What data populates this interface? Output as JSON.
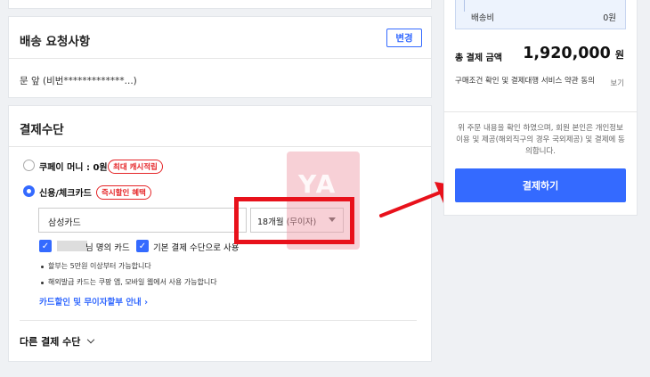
{
  "delivery_request": {
    "title": "배송 요청사항",
    "change_label": "변경",
    "value": "문 앞 (비번*************...)"
  },
  "payment": {
    "title": "결제수단",
    "coupay": {
      "label": "쿠페이 머니 : 0원",
      "badge": "최대 캐시적립"
    },
    "card": {
      "label": "신용/체크카드",
      "badge": "즉시할인 혜택",
      "card_select": "삼성카드",
      "installment_select": "18개월 (무이자)",
      "owner_suffix": "님 명의 카드",
      "default_label": "기본 결제 수단으로 사용",
      "notes": [
        "할부는 5만원 이상부터 가능합니다",
        "해외발급 카드는 쿠팡 앱, 모바일 웹에서 사용 가능합니다"
      ],
      "info_link": "카드할인 및 무이자할부 안내"
    },
    "other_methods": "다른 결제 수단"
  },
  "summary": {
    "shipping_label": "배송비",
    "shipping_value": "0원",
    "total_label": "총 결제 금액",
    "total_amount": "1,920,000",
    "total_unit": "원",
    "terms": "구매조건 확인 및 결제대행 서비스 약관 동의",
    "terms_view": "보기",
    "consent": "위 주문 내용을 확인 하였으며, 회원 본인은 개인정보 이용 및 제공(해외직구의 경우 국외제공) 및 결제에 동의합니다.",
    "pay_button": "결제하기"
  },
  "watermark": "YA",
  "colors": {
    "accent": "#346aff",
    "highlight_red": "#e8111b",
    "badge_red": "#e52528",
    "background": "#eff1f4"
  }
}
